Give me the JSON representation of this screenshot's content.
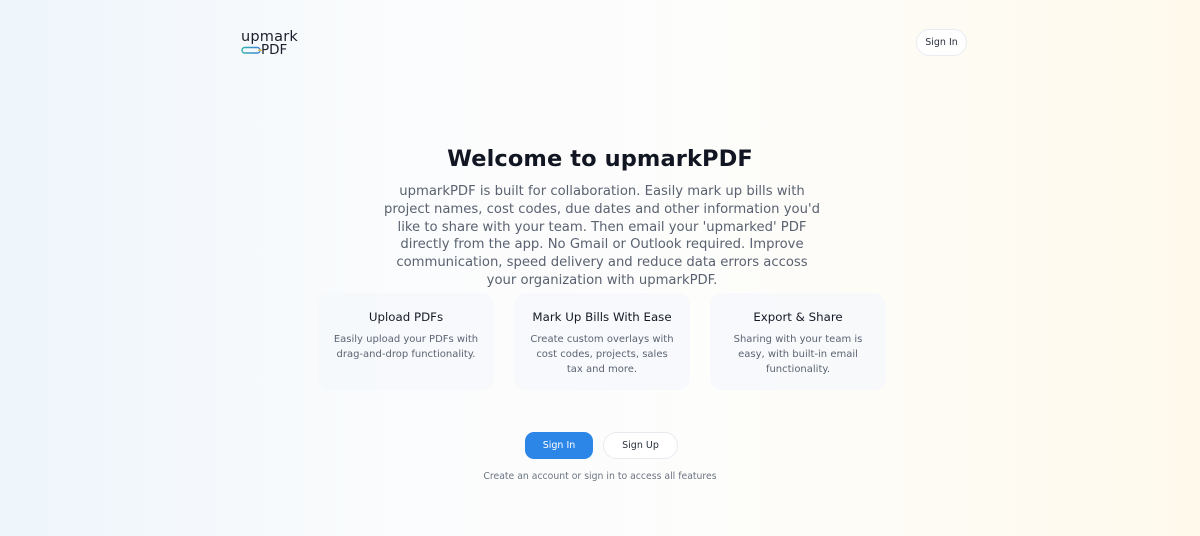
{
  "header": {
    "logo": {
      "word1": "upmark",
      "word2": "PDF"
    },
    "signin_label": "Sign In"
  },
  "hero": {
    "title": "Welcome to upmarkPDF",
    "description": "upmarkPDF is built for collaboration. Easily mark up bills with project names, cost codes, due dates and other information you'd like to share with your team. Then email your 'upmarked' PDF directly from the app. No Gmail or Outlook required. Improve communication, speed delivery and reduce data errors accoss your organization with upmarkPDF."
  },
  "features": [
    {
      "title": "Upload PDFs",
      "description": "Easily upload your PDFs with drag-and-drop functionality."
    },
    {
      "title": "Mark Up Bills With Ease",
      "description": "Create custom overlays with cost codes, projects, sales tax and more."
    },
    {
      "title": "Export & Share",
      "description": "Sharing with your team is easy, with built-in email functionality."
    }
  ],
  "cta": {
    "signin_label": "Sign In",
    "signup_label": "Sign Up",
    "note": "Create an account or sign in to access all features"
  },
  "colors": {
    "primary": "#2b86e8",
    "logo_stroke_start": "#2fb3a6",
    "logo_stroke_end": "#3f7fe0",
    "logo_accent": "#f0c33c"
  }
}
